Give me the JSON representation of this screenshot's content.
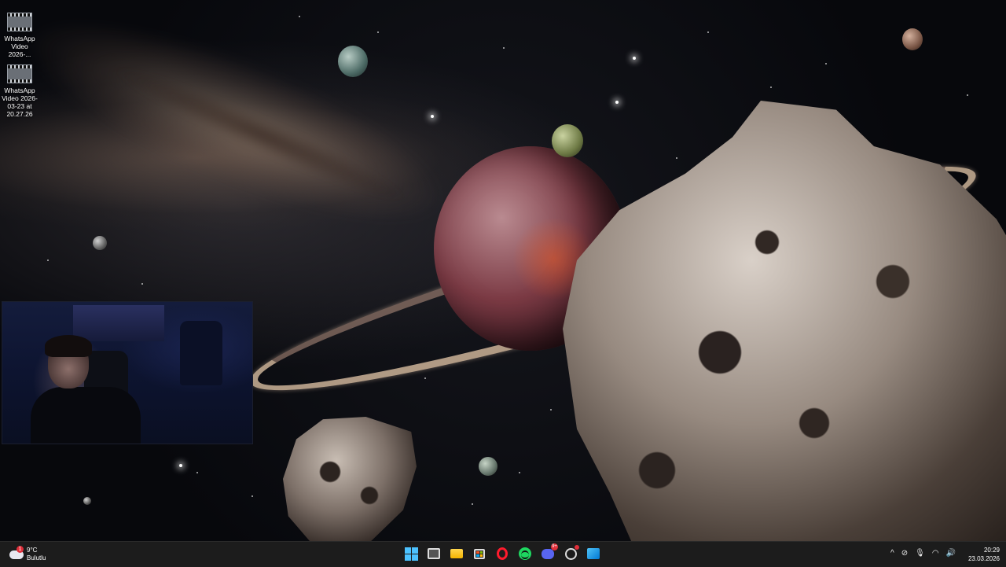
{
  "desktop": {
    "icons": [
      {
        "label": "WhatsApp Video 2026-...",
        "icon": "video-file-icon"
      },
      {
        "label": "WhatsApp Video 2026-03-23 at 20.27.26",
        "icon": "video-file-icon"
      }
    ]
  },
  "taskbar": {
    "weather": {
      "temp": "9°C",
      "condition": "Bulutlu",
      "badge": "1"
    },
    "apps": [
      {
        "name": "Start",
        "icon": "windows-icon"
      },
      {
        "name": "Task View",
        "icon": "task-view-icon"
      },
      {
        "name": "File Explorer",
        "icon": "folder-icon"
      },
      {
        "name": "Microsoft Store",
        "icon": "store-icon"
      },
      {
        "name": "Opera",
        "icon": "opera-icon"
      },
      {
        "name": "Spotify",
        "icon": "spotify-icon"
      },
      {
        "name": "Discord",
        "icon": "discord-icon",
        "badge": "9+"
      },
      {
        "name": "Clock",
        "icon": "clock-icon"
      },
      {
        "name": "Photos",
        "icon": "photos-icon"
      }
    ],
    "tray": {
      "chevron": "^",
      "icons": [
        "network-off-icon",
        "microphone-icon",
        "wifi-icon",
        "volume-icon"
      ]
    },
    "clock": {
      "time": "20:29",
      "date": "23.03.2026"
    }
  }
}
